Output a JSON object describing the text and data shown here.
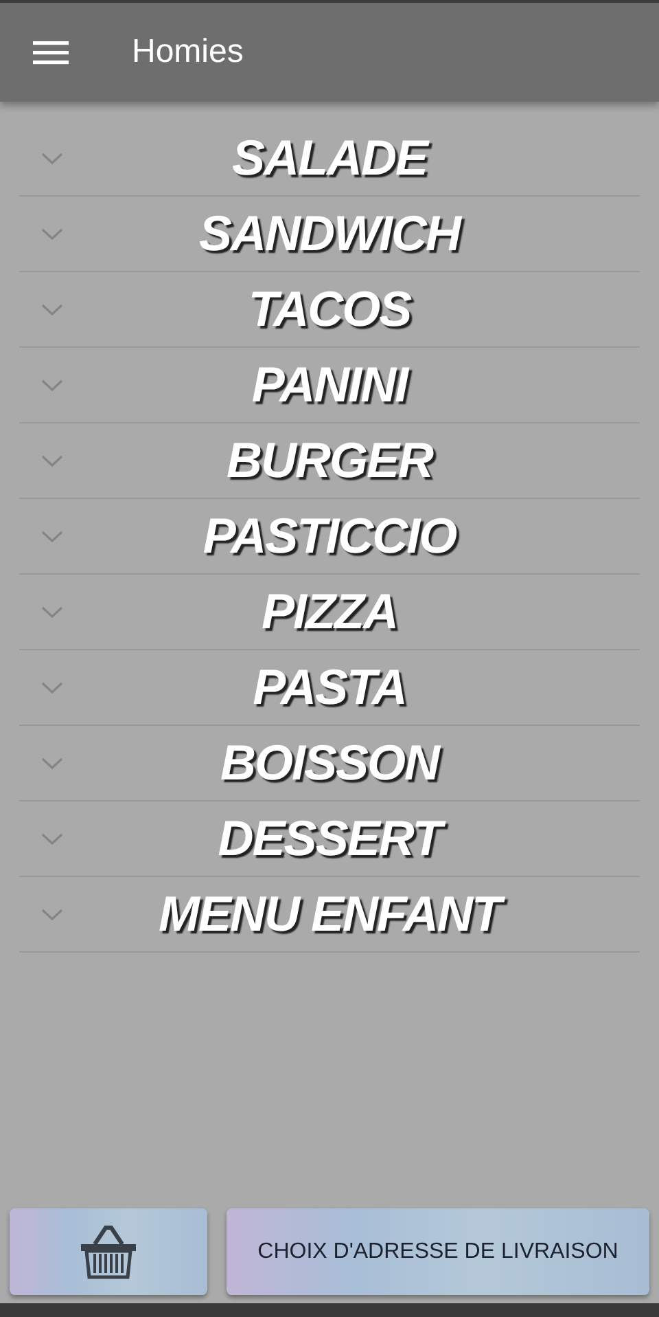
{
  "app_bar": {
    "title": "Homies"
  },
  "categories": [
    {
      "label": "SALADE"
    },
    {
      "label": "SANDWICH"
    },
    {
      "label": "TACOS"
    },
    {
      "label": "PANINI"
    },
    {
      "label": "BURGER"
    },
    {
      "label": "PASTICCIO"
    },
    {
      "label": "PIZZA"
    },
    {
      "label": "PASTA"
    },
    {
      "label": "BOISSON"
    },
    {
      "label": "DESSERT"
    },
    {
      "label": "MENU ENFANT"
    }
  ],
  "footer": {
    "address_button": "CHOIX D'ADRESSE DE LIVRAISON"
  }
}
